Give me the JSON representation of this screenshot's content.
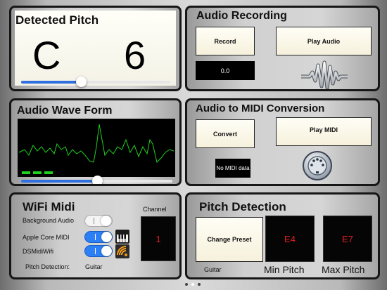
{
  "pitch_panel": {
    "title": "Detected Pitch",
    "note": "C",
    "octave": "6",
    "slider_level": 0.4
  },
  "recording_panel": {
    "title": "Audio Recording",
    "record_label": "Record",
    "play_label": "Play Audio",
    "time_value": "0.0",
    "waveform_icon": "waveform-icon"
  },
  "wave_panel": {
    "title": "Audio Wave Form",
    "trace_color": "#1fd21f",
    "level_bars": 3,
    "slider_level": 0.5
  },
  "midi_panel": {
    "title": "Audio to MIDI Conversion",
    "convert_label": "Convert",
    "play_label": "Play MIDI",
    "status": "No MIDI data",
    "connector_icon": "midi-connector-icon"
  },
  "wifi_panel": {
    "title": "WiFi Midi",
    "rows": [
      {
        "label": "Background Audio",
        "on": false,
        "icon": ""
      },
      {
        "label": "Apple Core MIDI",
        "on": true,
        "icon": "piano-keyboard-icon"
      },
      {
        "label": "DSMidiWifi",
        "on": true,
        "icon": "wifi-midi-icon"
      }
    ],
    "channel_label": "Channel",
    "channel_value": "1",
    "pitch_detection_label": "Pitch Detection:",
    "pitch_detection_value": "Guitar"
  },
  "detection_panel": {
    "title": "Pitch Detection",
    "preset_label": "Change Preset",
    "preset_value": "Guitar",
    "min_value": "E4",
    "max_value": "E7",
    "min_label": "Min Pitch",
    "max_label": "Max Pitch"
  },
  "pager": {
    "pages": 3,
    "current": 2
  },
  "colors": {
    "accent": "#2f6fe0",
    "lcd_text": "#e01d1d",
    "toggle_on": "#2d7ff5"
  }
}
